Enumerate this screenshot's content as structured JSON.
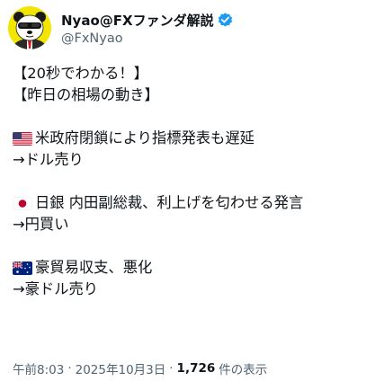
{
  "author": {
    "display_name": "Nyao@FXファンダ解説",
    "handle": "@FxNyao",
    "verified": true,
    "accent_color": "#1d9bf0"
  },
  "tweet": {
    "lines": [
      {
        "text": "【20秒でわかる！】"
      },
      {
        "text": "【昨日の相場の動き】"
      },
      {
        "text": "米政府閉鎖により指標発表も遅延",
        "flag": "us-flag-icon"
      },
      {
        "text": "→ドル売り"
      },
      {
        "text": "日銀 内田副総裁、利上げを匂わせる発言",
        "flag": "jp-flag-icon"
      },
      {
        "text": "→円買い"
      },
      {
        "text": "豪貿易収支、悪化",
        "flag": "au-flag-icon"
      },
      {
        "text": "→豪ドル売り"
      }
    ]
  },
  "meta": {
    "time": "午前8:03",
    "separator": "·",
    "date": "2025年10月3日",
    "views_count": "1,726",
    "views_label": "件の表示"
  }
}
